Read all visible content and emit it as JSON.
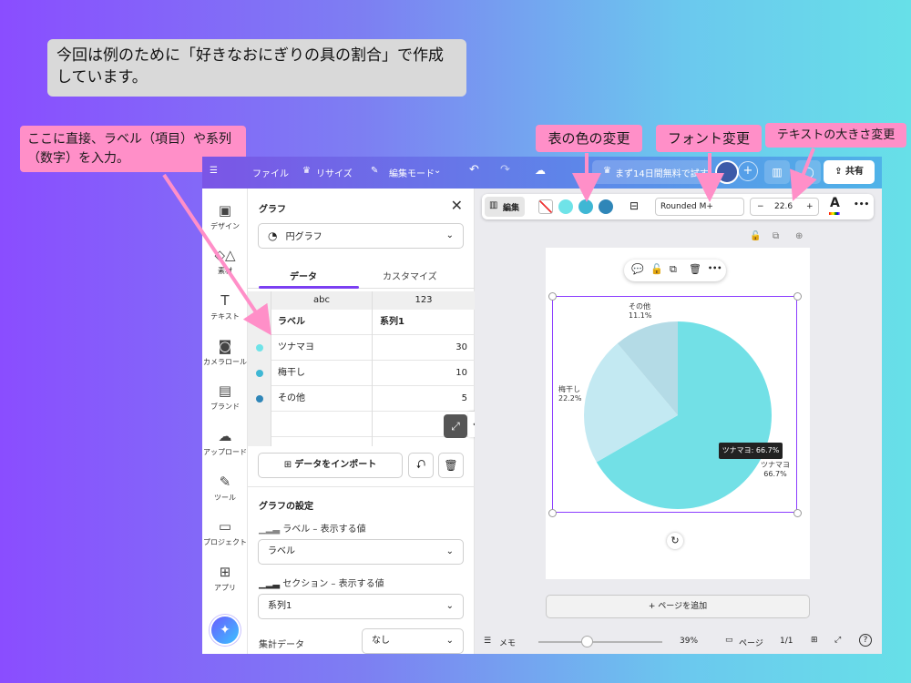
{
  "annotations": {
    "intro": "今回は例のために「好きなおにぎりの具の割合」で作成しています。",
    "left_callout": "ここに直接、ラベル（項目）や系列（数字）を入力。",
    "color_change": "表の色の変更",
    "font_change": "フォント変更",
    "text_size_change": "テキストの大きさ変更"
  },
  "topbar": {
    "file": "ファイル",
    "resize": "リサイズ",
    "edit_mode": "編集モード",
    "trial": "まず14日間無料で試す",
    "share": "共有"
  },
  "rail": [
    {
      "icon": "design-icon",
      "label": "デザイン"
    },
    {
      "icon": "elements-icon",
      "label": "素材"
    },
    {
      "icon": "text-icon",
      "label": "テキスト"
    },
    {
      "icon": "camera-icon",
      "label": "カメラロール"
    },
    {
      "icon": "brand-icon",
      "label": "ブランド"
    },
    {
      "icon": "upload-icon",
      "label": "アップロード"
    },
    {
      "icon": "tools-icon",
      "label": "ツール"
    },
    {
      "icon": "folder-icon",
      "label": "プロジェクト"
    },
    {
      "icon": "apps-icon",
      "label": "アプリ"
    }
  ],
  "panel": {
    "title": "グラフ",
    "chart_type": "円グラフ",
    "tabs": {
      "data": "データ",
      "customize": "カスタマイズ"
    },
    "col_types": [
      "abc",
      "123"
    ],
    "headers": [
      "ラベル",
      "系列1"
    ],
    "rows": [
      {
        "label": "ツナマヨ",
        "value": "30",
        "color": "#6fe3e8"
      },
      {
        "label": "梅干し",
        "value": "10",
        "color": "#3fb7d4"
      },
      {
        "label": "その他",
        "value": "5",
        "color": "#2f86b8"
      }
    ],
    "import_button": "データをインポート",
    "settings_title": "グラフの設定",
    "label_setting": "ラベル – 表示する値",
    "label_value": "ラベル",
    "section_setting": "セクション – 表示する値",
    "section_value": "系列1",
    "aggregate_label": "集計データ",
    "aggregate_value": "なし"
  },
  "toolbar": {
    "edit": "編集",
    "font": "Rounded M+",
    "size": "22.6",
    "minus": "−",
    "plus": "+",
    "more": "•••",
    "swatches": [
      "#6fe3e8",
      "#3fb7d4",
      "#2f86b8"
    ]
  },
  "canvas": {
    "tooltip": "ツナマヨ: 66.7%",
    "add_page": "+  ページを追加",
    "notes": "メモ",
    "zoom": "39%",
    "pages": "ページ",
    "page_count": "1/1",
    "help": "?"
  },
  "chart_data": {
    "type": "pie",
    "categories": [
      "ツナマヨ",
      "梅干し",
      "その他"
    ],
    "values": [
      30,
      10,
      5
    ],
    "labels": [
      "66.7%",
      "22.2%",
      "11.1%"
    ],
    "colors": [
      "#72e0e6",
      "#c3e9f2",
      "#b4dbe6"
    ]
  }
}
